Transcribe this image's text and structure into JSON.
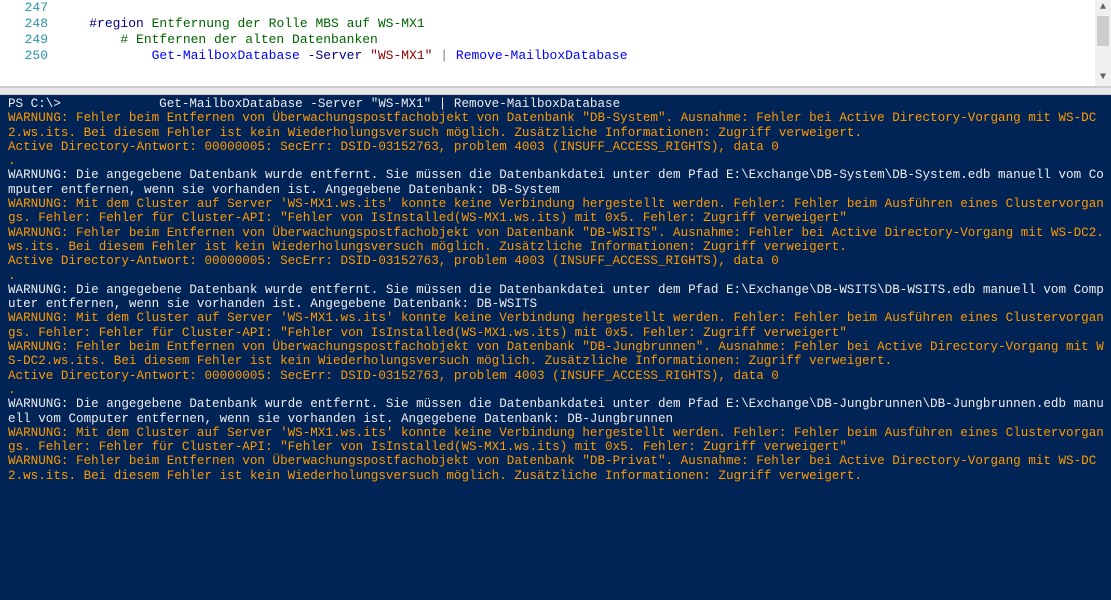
{
  "editor": {
    "lines": [
      {
        "num": "247",
        "tokens": []
      },
      {
        "num": "248",
        "tokens": [
          {
            "cls": "c-black",
            "pad": "    ",
            "text": ""
          },
          {
            "cls": "c-navy",
            "text": "#region"
          },
          {
            "cls": "c-green",
            "text": " Entfernung der Rolle MBS auf WS-MX1"
          }
        ]
      },
      {
        "num": "249",
        "tokens": [
          {
            "cls": "c-green",
            "pad": "        ",
            "text": "# Entfernen der alten Datenbanken"
          }
        ]
      },
      {
        "num": "250",
        "tokens": [
          {
            "cls": "c-black",
            "pad": "            ",
            "text": ""
          },
          {
            "cls": "c-blue",
            "text": "Get-MailboxDatabase"
          },
          {
            "cls": "c-navy",
            "text": " -Server "
          },
          {
            "cls": "c-maroon",
            "text": "\"WS-MX1\""
          },
          {
            "cls": "c-grey",
            "text": " | "
          },
          {
            "cls": "c-blue",
            "text": "Remove-MailboxDatabase"
          }
        ]
      }
    ]
  },
  "console": {
    "prompt": "PS C:\\>             Get-MailboxDatabase -Server \"WS-MX1\" | Remove-MailboxDatabase",
    "lines": [
      {
        "cls": "warn",
        "text": "WARNUNG: Fehler beim Entfernen von Überwachungspostfachobjekt von Datenbank \"DB-System\". Ausnahme: Fehler bei Active Directory-Vorgang mit WS-DC2.ws.its. Bei diesem Fehler ist kein Wiederholungsversuch möglich. Zusätzliche Informationen: Zugriff verweigert."
      },
      {
        "cls": "warn",
        "text": "Active Directory-Antwort: 00000005: SecErr: DSID-03152763, problem 4003 (INSUFF_ACCESS_RIGHTS), data 0"
      },
      {
        "cls": "warn",
        "text": "."
      },
      {
        "cls": "white",
        "text": "WARNUNG: Die angegebene Datenbank wurde entfernt. Sie müssen die Datenbankdatei unter dem Pfad E:\\Exchange\\DB-System\\DB-System.edb manuell vom Computer entfernen, wenn sie vorhanden ist. Angegebene Datenbank: DB-System"
      },
      {
        "cls": "warn",
        "text": "WARNUNG: Mit dem Cluster auf Server 'WS-MX1.ws.its' konnte keine Verbindung hergestellt werden. Fehler: Fehler beim Ausführen eines Clustervorgangs. Fehler: Fehler für Cluster-API: \"Fehler von IsInstalled(WS-MX1.ws.its) mit 0x5. Fehler: Zugriff verweigert\""
      },
      {
        "cls": "warn",
        "text": "WARNUNG: Fehler beim Entfernen von Überwachungspostfachobjekt von Datenbank \"DB-WSITS\". Ausnahme: Fehler bei Active Directory-Vorgang mit WS-DC2.ws.its. Bei diesem Fehler ist kein Wiederholungsversuch möglich. Zusätzliche Informationen: Zugriff verweigert."
      },
      {
        "cls": "warn",
        "text": "Active Directory-Antwort: 00000005: SecErr: DSID-03152763, problem 4003 (INSUFF_ACCESS_RIGHTS), data 0"
      },
      {
        "cls": "warn",
        "text": "."
      },
      {
        "cls": "white",
        "text": "WARNUNG: Die angegebene Datenbank wurde entfernt. Sie müssen die Datenbankdatei unter dem Pfad E:\\Exchange\\DB-WSITS\\DB-WSITS.edb manuell vom Computer entfernen, wenn sie vorhanden ist. Angegebene Datenbank: DB-WSITS"
      },
      {
        "cls": "warn",
        "text": "WARNUNG: Mit dem Cluster auf Server 'WS-MX1.ws.its' konnte keine Verbindung hergestellt werden. Fehler: Fehler beim Ausführen eines Clustervorgangs. Fehler: Fehler für Cluster-API: \"Fehler von IsInstalled(WS-MX1.ws.its) mit 0x5. Fehler: Zugriff verweigert\""
      },
      {
        "cls": "warn",
        "text": "WARNUNG: Fehler beim Entfernen von Überwachungspostfachobjekt von Datenbank \"DB-Jungbrunnen\". Ausnahme: Fehler bei Active Directory-Vorgang mit WS-DC2.ws.its. Bei diesem Fehler ist kein Wiederholungsversuch möglich. Zusätzliche Informationen: Zugriff verweigert."
      },
      {
        "cls": "warn",
        "text": "Active Directory-Antwort: 00000005: SecErr: DSID-03152763, problem 4003 (INSUFF_ACCESS_RIGHTS), data 0"
      },
      {
        "cls": "warn",
        "text": "."
      },
      {
        "cls": "white",
        "text": "WARNUNG: Die angegebene Datenbank wurde entfernt. Sie müssen die Datenbankdatei unter dem Pfad E:\\Exchange\\DB-Jungbrunnen\\DB-Jungbrunnen.edb manuell vom Computer entfernen, wenn sie vorhanden ist. Angegebene Datenbank: DB-Jungbrunnen"
      },
      {
        "cls": "warn",
        "text": "WARNUNG: Mit dem Cluster auf Server 'WS-MX1.ws.its' konnte keine Verbindung hergestellt werden. Fehler: Fehler beim Ausführen eines Clustervorgangs. Fehler: Fehler für Cluster-API: \"Fehler von IsInstalled(WS-MX1.ws.its) mit 0x5. Fehler: Zugriff verweigert\""
      },
      {
        "cls": "warn",
        "text": "WARNUNG: Fehler beim Entfernen von Überwachungspostfachobjekt von Datenbank \"DB-Privat\". Ausnahme: Fehler bei Active Directory-Vorgang mit WS-DC2.ws.its. Bei diesem Fehler ist kein Wiederholungsversuch möglich. Zusätzliche Informationen: Zugriff verweigert."
      }
    ]
  }
}
